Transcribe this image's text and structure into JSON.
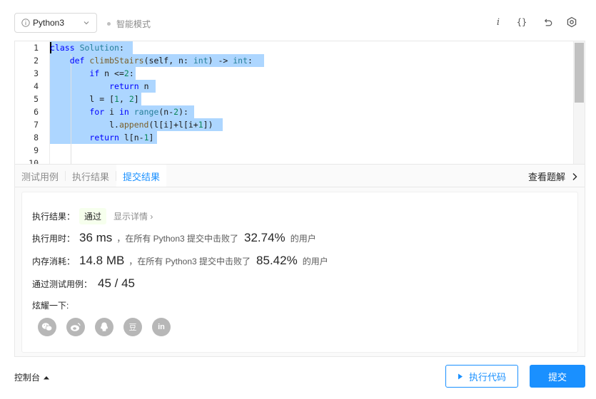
{
  "toolbar": {
    "language": "Python3",
    "mode_label": "智能模式",
    "icons": [
      "info-italic-icon",
      "braces-icon",
      "reset-icon",
      "settings-icon"
    ],
    "info_glyph": "i",
    "braces_glyph": "{}"
  },
  "editor": {
    "line_numbers": [
      "1",
      "2",
      "3",
      "4",
      "5",
      "6",
      "7",
      "8",
      "9",
      "10"
    ],
    "lines": [
      "class Solution:",
      "    def climbStairs(self, n: int) -> int:",
      "        if n <=2:",
      "            return n",
      "        l = [1, 2]",
      "        for i in range(n-2):",
      "            l.append(l[i]+l[i+1])",
      "        return l[n-1]",
      "",
      ""
    ]
  },
  "tabs": {
    "items": [
      "测试用例",
      "执行结果",
      "提交结果"
    ],
    "active": "提交结果",
    "view_solution": "查看题解"
  },
  "result": {
    "status_label": "执行结果：",
    "status_value": "通过",
    "detail_link": "显示详情 ›",
    "runtime_label": "执行用时：",
    "runtime_value": "36 ms",
    "runtime_mid": "，在所有 Python3 提交中击败了",
    "runtime_pct": "32.74%",
    "runtime_tail": "的用户",
    "memory_label": "内存消耗：",
    "memory_value": "14.8 MB",
    "memory_mid": "，在所有 Python3 提交中击败了",
    "memory_pct": "85.42%",
    "memory_tail": "的用户",
    "tests_label": "通过测试用例：",
    "tests_value": "45 / 45",
    "share_label": "炫耀一下:",
    "share_icons": [
      "wechat-icon",
      "weibo-icon",
      "qq-icon",
      "douban-icon",
      "linkedin-icon"
    ],
    "douban_glyph": "豆",
    "linkedin_glyph": "in"
  },
  "footer": {
    "console_label": "控制台",
    "run_label": "执行代码",
    "submit_label": "提交"
  },
  "colors": {
    "accent": "#1a90ff",
    "selection": "#add6ff",
    "pass_badge_bg": "#f6ffed"
  }
}
